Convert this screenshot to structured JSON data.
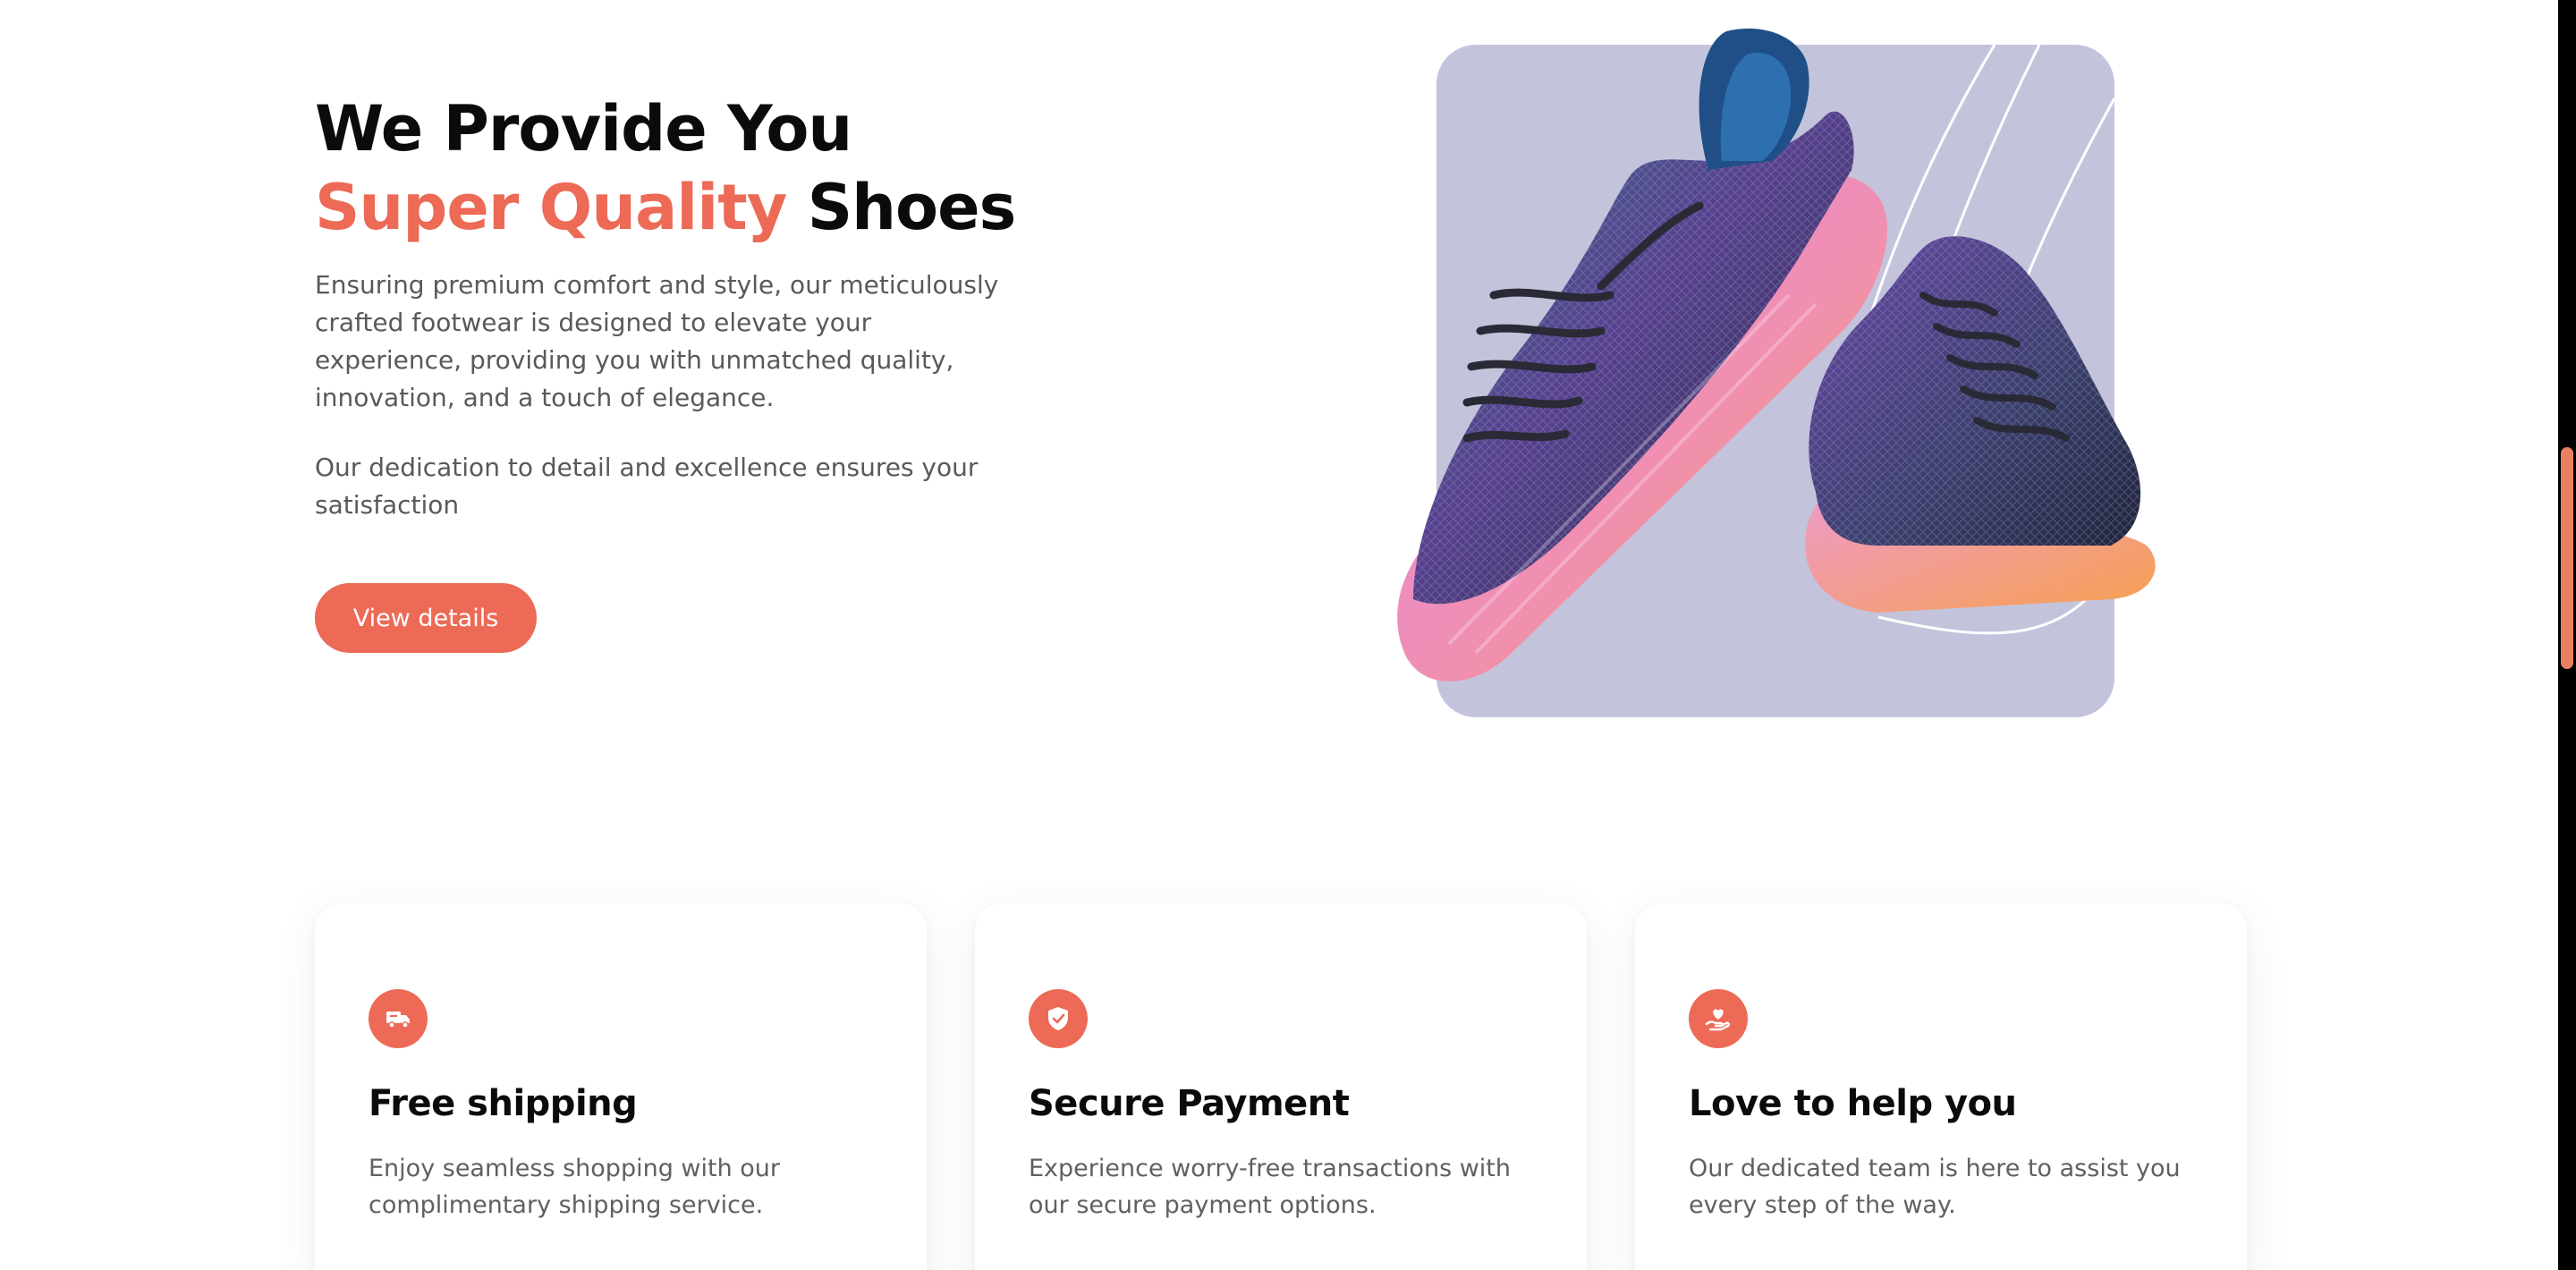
{
  "hero": {
    "title_part1": "We Provide You ",
    "title_accent": "Super Quality",
    "title_part2": " Shoes",
    "paragraph1": "Ensuring premium comfort and style, our meticulously crafted footwear is designed to elevate your experience, providing you with unmatched quality, innovation, and a touch of elegance.",
    "paragraph2": "Our dedication to detail and excellence ensures your satisfaction",
    "button_label": "View details",
    "image_icon": "sneakers-image"
  },
  "features": [
    {
      "icon": "delivery-truck-icon",
      "title": "Free shipping",
      "description": "Enjoy seamless shopping with our complimentary shipping service."
    },
    {
      "icon": "shield-check-icon",
      "title": "Secure Payment",
      "description": "Experience worry-free transactions with our secure payment options."
    },
    {
      "icon": "heart-hand-icon",
      "title": "Love to help you",
      "description": "Our dedicated team is here to assist you every step of the way."
    }
  ],
  "colors": {
    "accent": "#ec6a56",
    "image_background": "#c3c4dc",
    "heading": "#0b0b0b",
    "body_text": "#595959",
    "scrollbar": "#e9805f"
  }
}
